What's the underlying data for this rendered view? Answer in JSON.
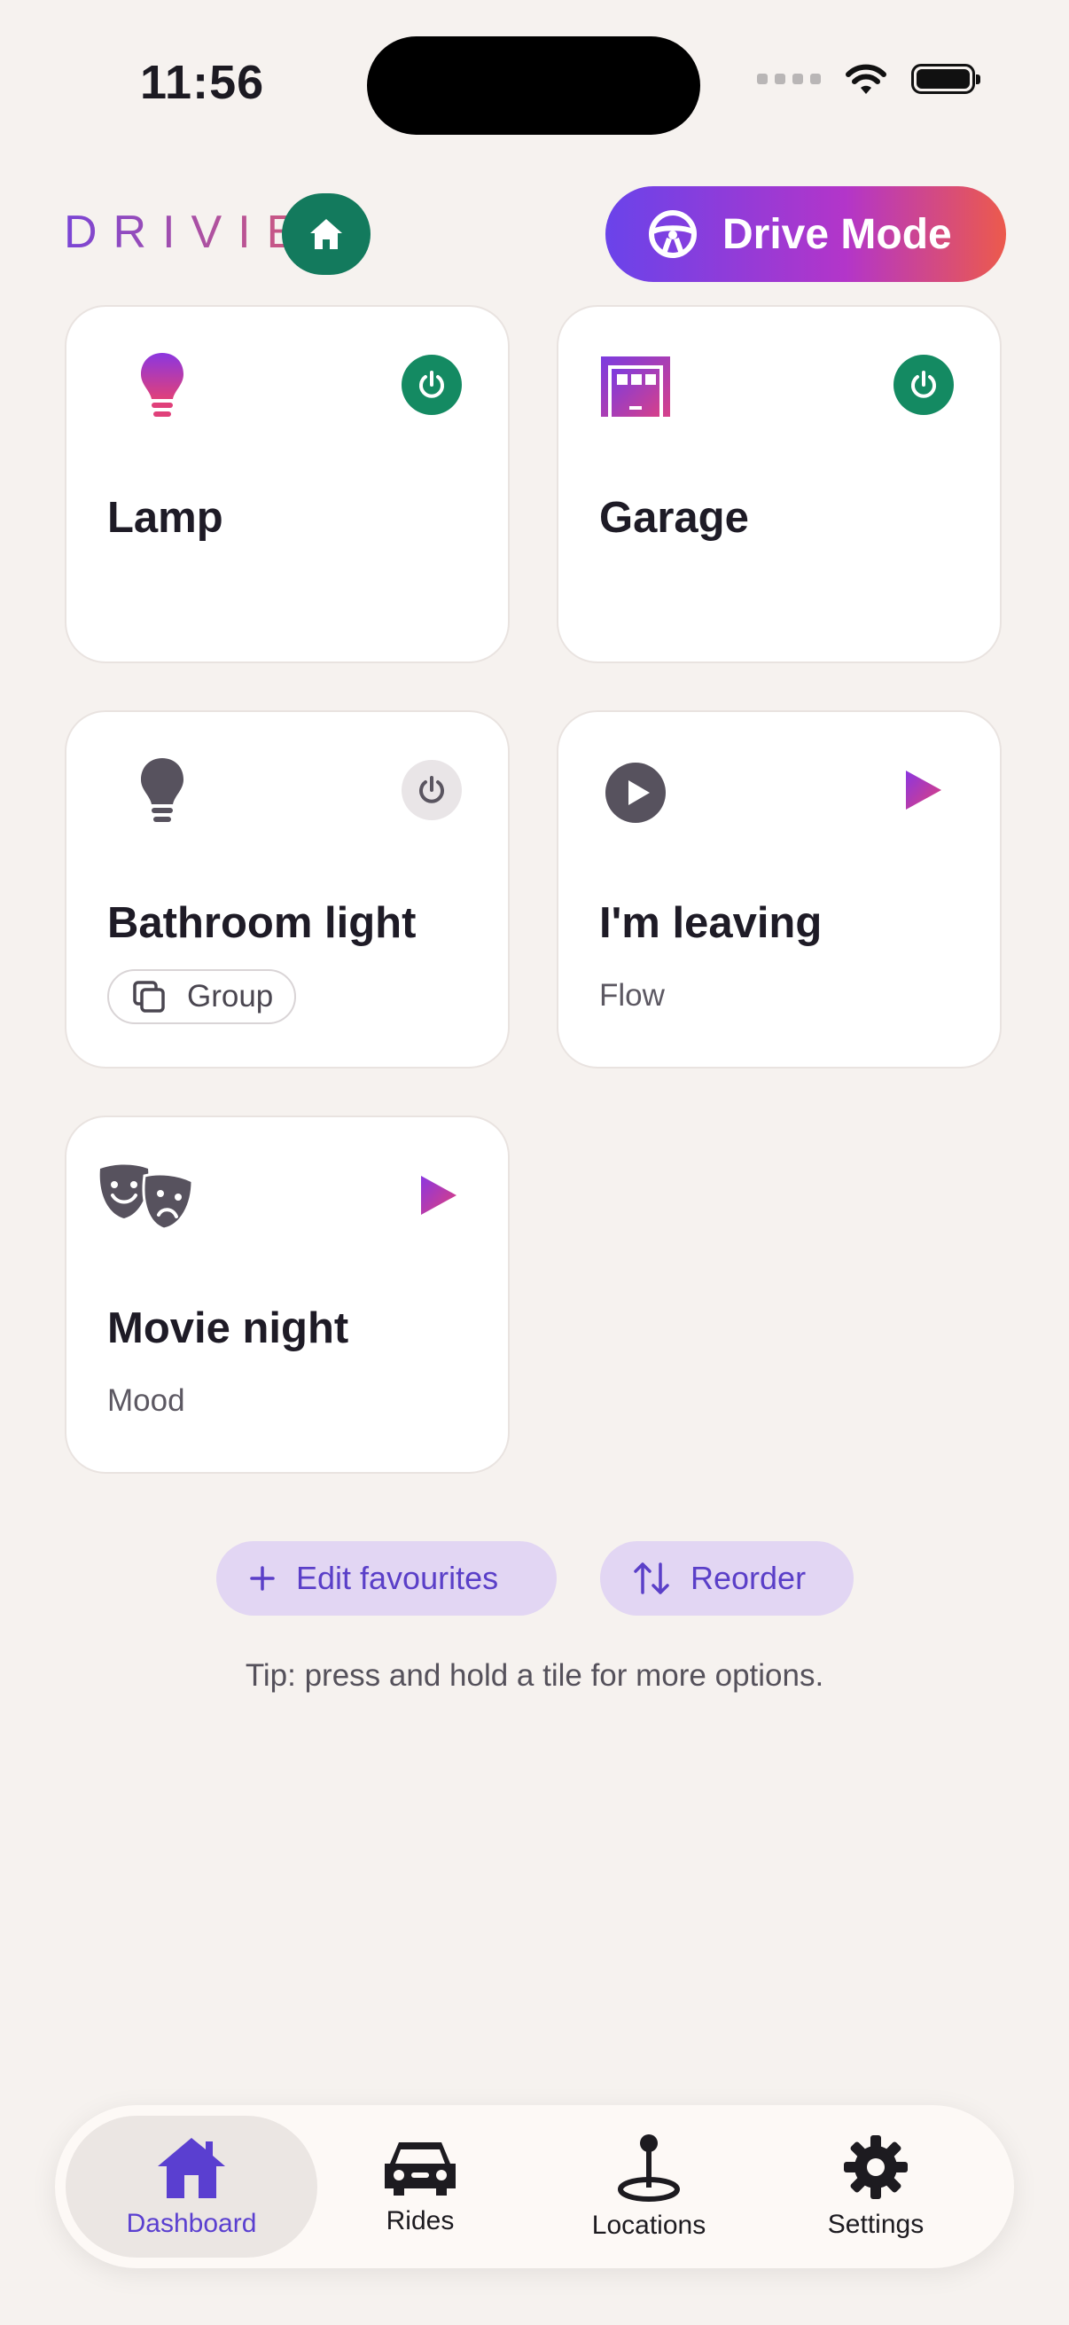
{
  "status_bar": {
    "time": "11:56"
  },
  "header": {
    "brand": "DRIVIE",
    "drive_mode_label": "Drive Mode"
  },
  "tiles": [
    {
      "title": "Lamp",
      "icon": "bulb-icon",
      "action": "power",
      "state": "on"
    },
    {
      "title": "Garage",
      "icon": "garage-icon",
      "action": "power",
      "state": "on"
    },
    {
      "title": "Bathroom light",
      "icon": "bulb-icon",
      "action": "power",
      "state": "off",
      "chip": "Group"
    },
    {
      "title": "I'm leaving",
      "icon": "play-circle-icon",
      "action": "play",
      "subtitle": "Flow"
    },
    {
      "title": "Movie night",
      "icon": "theater-masks-icon",
      "action": "play",
      "subtitle": "Mood"
    }
  ],
  "actions": {
    "edit_label": "Edit favourites",
    "reorder_label": "Reorder"
  },
  "tip": "Tip: press and hold a tile for more options.",
  "nav": [
    {
      "label": "Dashboard",
      "icon": "home-icon",
      "active": true
    },
    {
      "label": "Rides",
      "icon": "car-icon",
      "active": false
    },
    {
      "label": "Locations",
      "icon": "location-pin-icon",
      "active": false
    },
    {
      "label": "Settings",
      "icon": "gear-icon",
      "active": false
    }
  ],
  "colors": {
    "accent": "#5a3fc8",
    "power_on": "#148a62",
    "background": "#f6f2ef"
  }
}
